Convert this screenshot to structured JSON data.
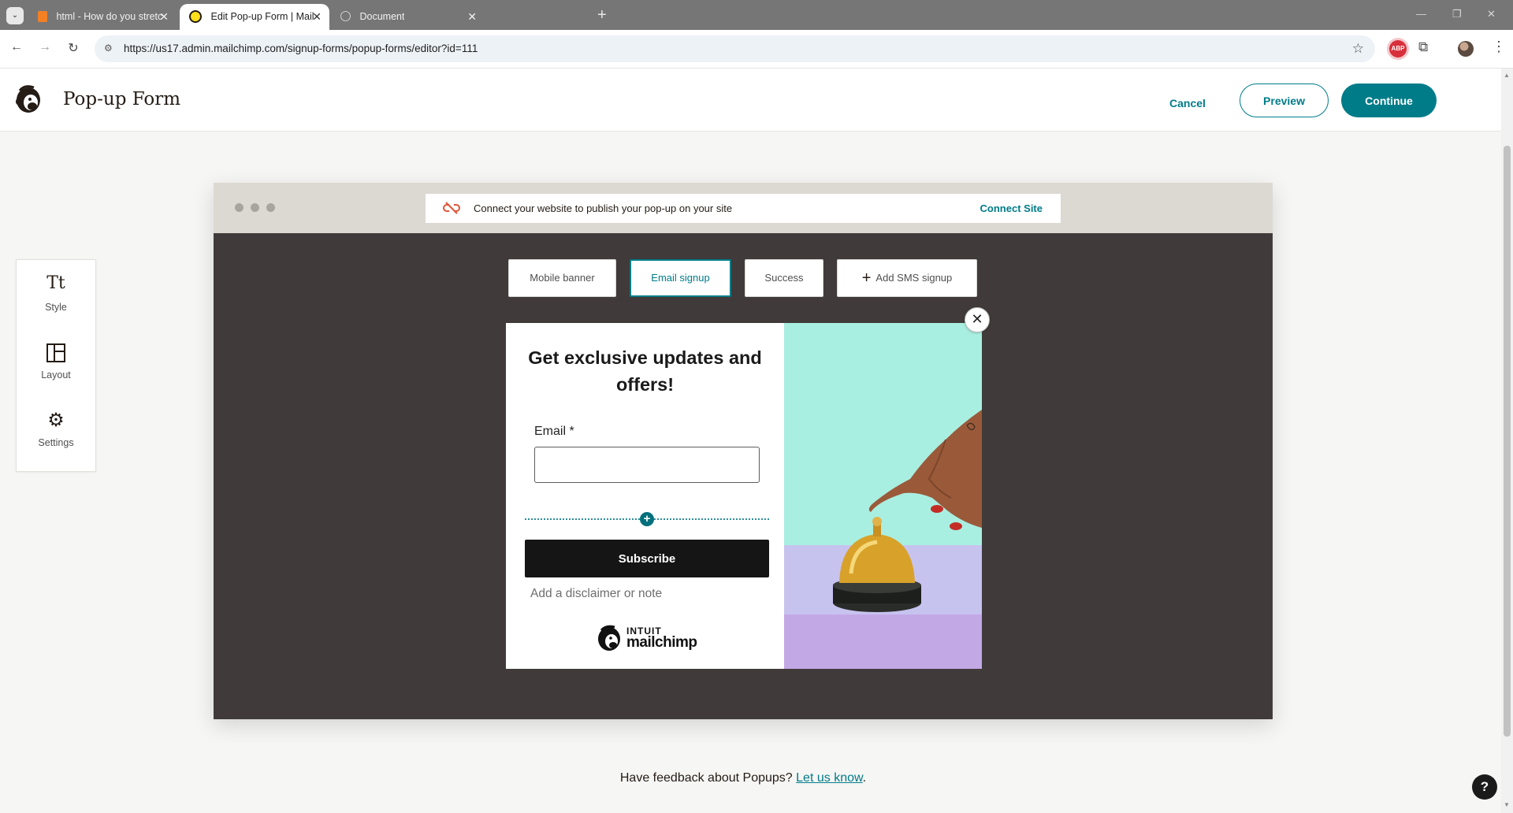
{
  "browser": {
    "tabs": [
      {
        "title": "html - How do you stretch an in",
        "active": false
      },
      {
        "title": "Edit Pop-up Form | Mailchimp",
        "active": true
      },
      {
        "title": "Document",
        "active": false
      }
    ],
    "url": "https://us17.admin.mailchimp.com/signup-forms/popup-forms/editor?id=111",
    "adblock_label": "ABP"
  },
  "header": {
    "title": "Pop-up Form",
    "cancel_label": "Cancel",
    "preview_label": "Preview",
    "continue_label": "Continue"
  },
  "sidebar": {
    "tools": [
      {
        "label": "Style",
        "icon": "text-style-icon",
        "glyph": "Tt"
      },
      {
        "label": "Layout",
        "icon": "layout-icon",
        "glyph": ""
      },
      {
        "label": "Settings",
        "icon": "gear-icon",
        "glyph": "⚙"
      }
    ]
  },
  "preview": {
    "connect_message": "Connect your website to publish your pop-up on your site",
    "connect_link": "Connect Site",
    "state_tabs": [
      {
        "label": "Mobile banner",
        "selected": false
      },
      {
        "label": "Email signup",
        "selected": true
      },
      {
        "label": "Success",
        "selected": false
      },
      {
        "label": "Add SMS signup",
        "selected": false
      }
    ]
  },
  "popup": {
    "heading": "Get exclusive updates and offers!",
    "email_label": "Email *",
    "email_value": "",
    "subscribe_label": "Subscribe",
    "disclaimer": "Add a disclaimer or note",
    "logo_top": "INTUIT",
    "logo_bottom": "mailchimp",
    "image": "hand-ringing-service-bell"
  },
  "footer": {
    "feedback_text": "Have feedback about Popups?",
    "feedback_link": "Let us know",
    "feedback_end": ".",
    "help_label": "?"
  },
  "colors": {
    "accent": "#007c89",
    "frame_bg": "#403b3a",
    "page_bg": "#f6f6f4",
    "subscribe_bg": "#151515"
  }
}
